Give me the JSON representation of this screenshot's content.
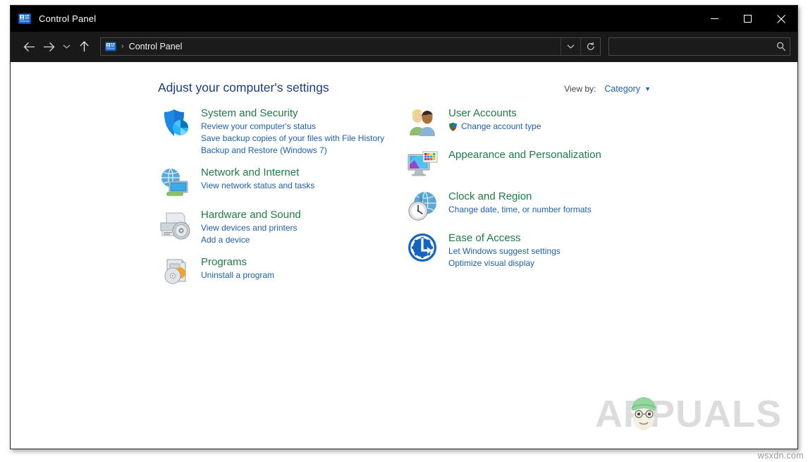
{
  "window": {
    "title": "Control Panel",
    "title_icon": "control-panel-icon",
    "controls": {
      "minimize": "Minimize",
      "maximize": "Maximize",
      "close": "Close"
    }
  },
  "navbar": {
    "back": "Back",
    "forward": "Forward",
    "recent": "Recent locations",
    "up": "Up one level",
    "address": {
      "icon": "control-panel-icon",
      "separator": "›",
      "crumb": "Control Panel",
      "dropdown": "Previous locations",
      "refresh": "Refresh"
    },
    "search": {
      "value": "",
      "placeholder": "",
      "icon": "search-icon"
    }
  },
  "content": {
    "page_title": "Adjust your computer's settings",
    "view_by": {
      "label": "View by:",
      "value": "Category",
      "caret": "▼"
    },
    "left_column": [
      {
        "icon": "system-and-security-icon",
        "title": "System and Security",
        "links": [
          {
            "text": "Review your computer's status",
            "shield": false
          },
          {
            "text": "Save backup copies of your files with File History",
            "shield": false
          },
          {
            "text": "Backup and Restore (Windows 7)",
            "shield": false
          }
        ]
      },
      {
        "icon": "network-and-internet-icon",
        "title": "Network and Internet",
        "links": [
          {
            "text": "View network status and tasks",
            "shield": false
          }
        ]
      },
      {
        "icon": "hardware-and-sound-icon",
        "title": "Hardware and Sound",
        "links": [
          {
            "text": "View devices and printers",
            "shield": false
          },
          {
            "text": "Add a device",
            "shield": false
          }
        ]
      },
      {
        "icon": "programs-icon",
        "title": "Programs",
        "links": [
          {
            "text": "Uninstall a program",
            "shield": false
          }
        ]
      }
    ],
    "right_column": [
      {
        "icon": "user-accounts-icon",
        "title": "User Accounts",
        "links": [
          {
            "text": "Change account type",
            "shield": true
          }
        ]
      },
      {
        "icon": "appearance-and-personalization-icon",
        "title": "Appearance and Personalization",
        "links": []
      },
      {
        "icon": "clock-and-region-icon",
        "title": "Clock and Region",
        "links": [
          {
            "text": "Change date, time, or number formats",
            "shield": false
          }
        ]
      },
      {
        "icon": "ease-of-access-icon",
        "title": "Ease of Access",
        "links": [
          {
            "text": "Let Windows suggest settings",
            "shield": false
          },
          {
            "text": "Optimize visual display",
            "shield": false
          }
        ]
      }
    ],
    "watermark": "APPUALS"
  },
  "site_tag": "wsxdn.com",
  "colors": {
    "titlebar_bg": "#000000",
    "navbar_bg": "#191919",
    "content_bg": "#ffffff",
    "heading": "#1a3d7c",
    "category_title": "#1f7a45",
    "link": "#1f5fae",
    "watermark": "#dcdcdc"
  }
}
